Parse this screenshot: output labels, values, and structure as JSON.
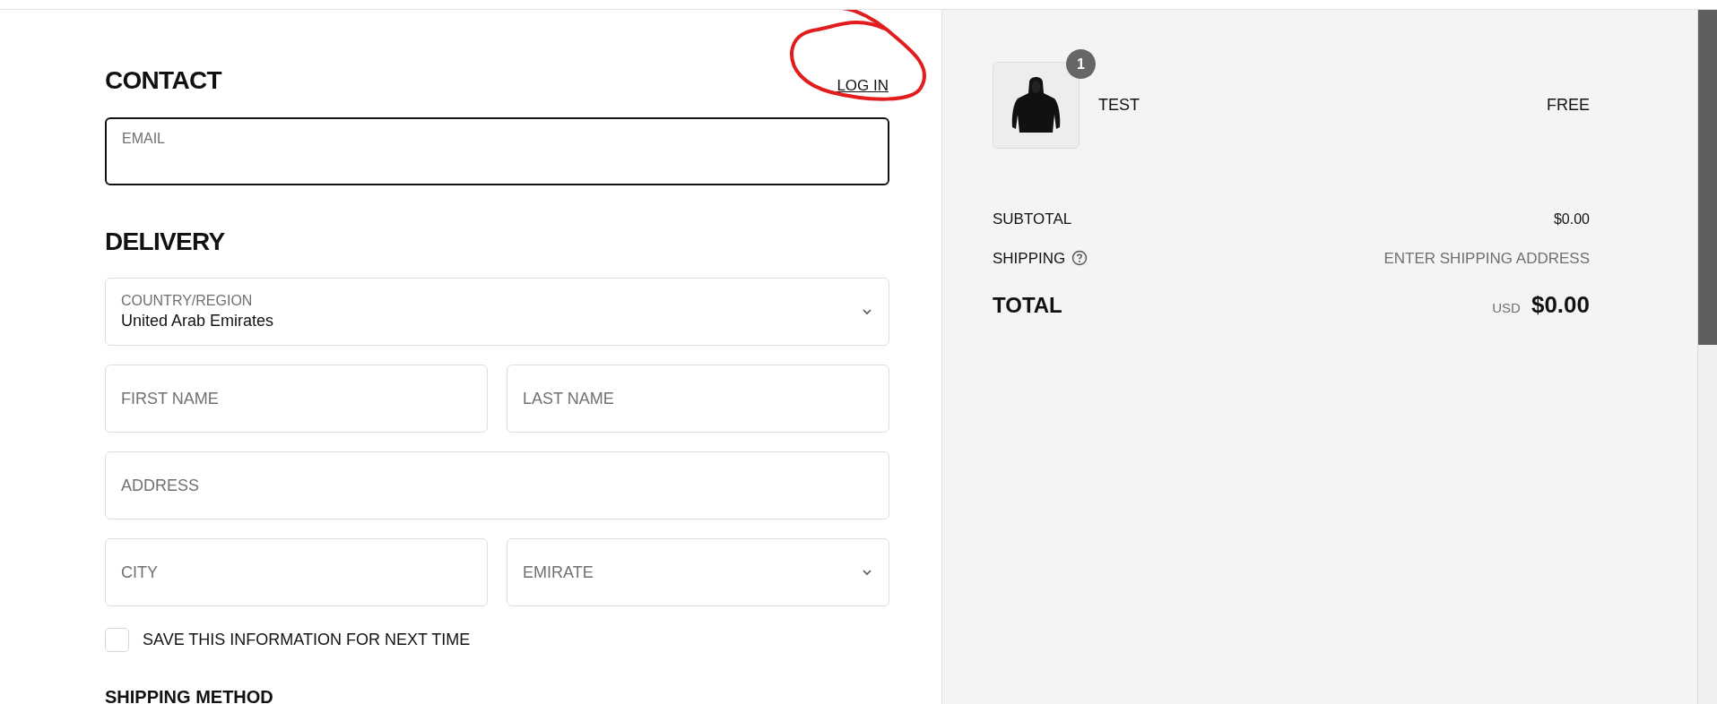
{
  "contact": {
    "heading": "CONTACT",
    "login_link": "LOG IN",
    "email": {
      "placeholder": "EMAIL",
      "focused": true
    }
  },
  "delivery": {
    "heading": "DELIVERY",
    "rows": [
      [
        {
          "kind": "select",
          "placeholder": "COUNTRY/REGION",
          "value": "United Arab Emirates"
        }
      ],
      [
        {
          "kind": "text",
          "placeholder": "FIRST NAME"
        },
        {
          "kind": "text",
          "placeholder": "LAST NAME"
        }
      ],
      [
        {
          "kind": "text",
          "placeholder": "ADDRESS"
        }
      ],
      [
        {
          "kind": "text",
          "placeholder": "CITY"
        },
        {
          "kind": "select",
          "placeholder": "EMIRATE"
        }
      ]
    ],
    "save_info": {
      "label": "SAVE THIS INFORMATION FOR NEXT TIME",
      "checked": false
    }
  },
  "shipping_method": {
    "heading": "SHIPPING METHOD"
  },
  "summary": {
    "items": [
      {
        "kind": "picture",
        "quantity": "1",
        "name": "TEST",
        "price": "FREE"
      }
    ],
    "subtotal": {
      "label": "SUBTOTAL",
      "value": "$0.00"
    },
    "shipping": {
      "label": "SHIPPING",
      "value": "ENTER SHIPPING ADDRESS"
    },
    "total": {
      "label": "TOTAL",
      "currency": "USD",
      "value": "$0.00"
    }
  }
}
